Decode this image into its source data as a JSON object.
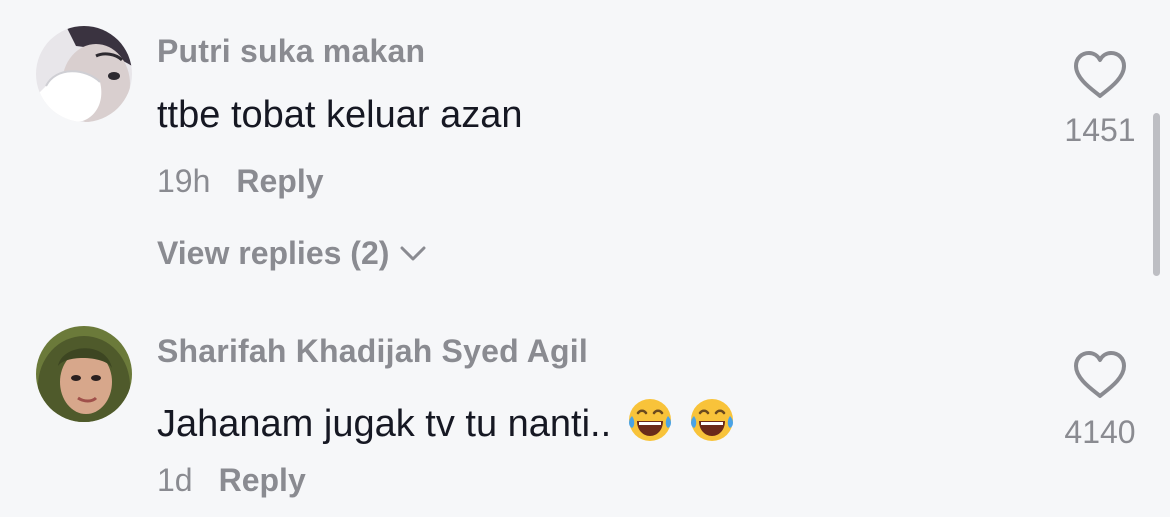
{
  "comments": [
    {
      "username": "Putri suka makan",
      "text": "ttbe tobat keluar azan",
      "time": "19h",
      "reply_label": "Reply",
      "likes": "1451",
      "view_replies": "View replies (2)"
    },
    {
      "username": "Sharifah Khadijah Syed Agil",
      "text": "Jahanam jugak tv tu nanti..",
      "emojis": [
        "face-with-tears-of-joy",
        "face-with-tears-of-joy"
      ],
      "time": "1d",
      "reply_label": "Reply",
      "likes": "4140"
    }
  ],
  "colors": {
    "background": "#f6f7f9",
    "text": "#161823",
    "secondary": "#8a8b91"
  }
}
